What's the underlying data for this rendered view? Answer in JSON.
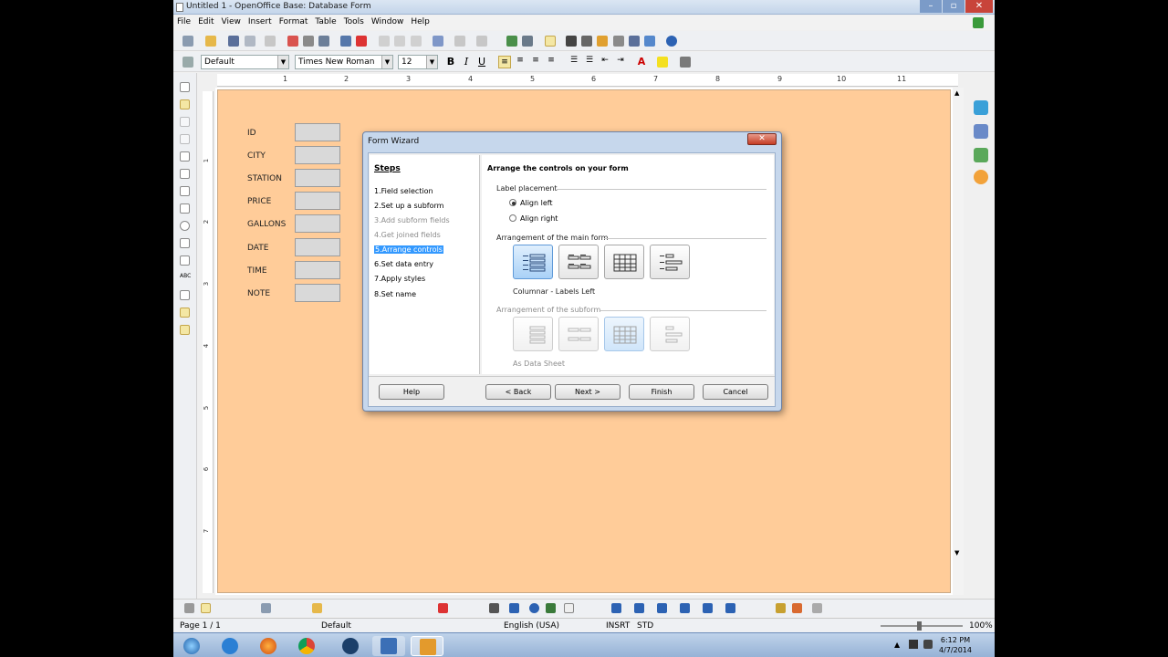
{
  "window": {
    "title": "Untitled 1 - OpenOffice Base: Database Form"
  },
  "menu": [
    "File",
    "Edit",
    "View",
    "Insert",
    "Format",
    "Table",
    "Tools",
    "Window",
    "Help"
  ],
  "format_bar": {
    "style": "Default",
    "font": "Times New Roman",
    "size": "12"
  },
  "ruler": {
    "h_marks": [
      "1",
      "2",
      "3",
      "4",
      "5",
      "6",
      "7",
      "8",
      "9",
      "10",
      "11"
    ],
    "v_marks": [
      "1",
      "2",
      "3",
      "4",
      "5",
      "6",
      "7"
    ]
  },
  "form": {
    "fields": [
      "ID",
      "CITY",
      "STATION",
      "PRICE",
      "GALLONS",
      "DATE",
      "TIME",
      "NOTE"
    ]
  },
  "wizard": {
    "title": "Form Wizard",
    "steps_heading": "Steps",
    "steps": [
      "1.Field selection",
      "2.Set up a subform",
      "3.Add subform fields",
      "4.Get joined fields",
      "5.Arrange controls",
      "6.Set data entry",
      "7.Apply styles",
      "8.Set name"
    ],
    "heading": "Arrange the controls on your form",
    "label_placement": "Label placement",
    "align_left": "Align left",
    "align_right": "Align right",
    "main_arrangement": "Arrangement of the main form",
    "main_caption": "Columnar - Labels Left",
    "sub_arrangement": "Arrangement of the subform",
    "sub_caption": "As Data Sheet",
    "buttons": {
      "help": "Help",
      "back": "< Back",
      "next": "Next >",
      "finish": "Finish",
      "cancel": "Cancel"
    }
  },
  "status": {
    "page": "Page 1 / 1",
    "style": "Default",
    "lang": "English (USA)",
    "insrt": "INSRT",
    "std": "STD",
    "zoom": "100%"
  },
  "clock": {
    "time": "6:12 PM",
    "date": "4/7/2014"
  }
}
